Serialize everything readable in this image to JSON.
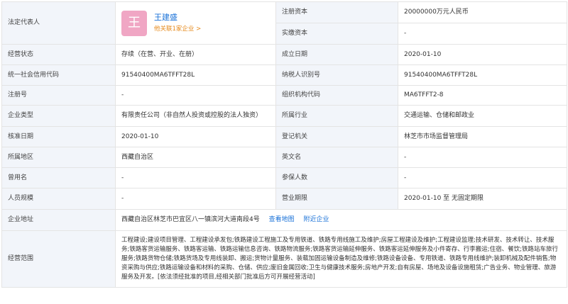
{
  "rows": {
    "legal_rep_label": "法定代表人",
    "rep_avatar_char": "王",
    "rep_name": "王建盛",
    "rep_link": "他关联1家企业 >",
    "reg_capital_label": "注册资本",
    "reg_capital_value": "20000000万元人民币",
    "paid_capital_label": "实缴资本",
    "paid_capital_value": "-",
    "status_label": "经营状态",
    "status_value": "存续（在营、开业、在册）",
    "established_label": "成立日期",
    "established_value": "2020-01-10",
    "credit_code_label": "统一社会信用代码",
    "credit_code_value": "91540400MA6TFFT28L",
    "taxpayer_label": "纳税人识别号",
    "taxpayer_value": "91540400MA6TFFT28L",
    "reg_no_label": "注册号",
    "reg_no_value": "-",
    "org_code_label": "组织机构代码",
    "org_code_value": "MA6TFFT2-8",
    "type_label": "企业类型",
    "type_value": "有限责任公司（非自然人投资或控股的法人独资）",
    "industry_label": "所属行业",
    "industry_value": "交通运输、仓储和邮政业",
    "approval_label": "核准日期",
    "approval_value": "2020-01-10",
    "authority_label": "登记机关",
    "authority_value": "林芝市市场监督管理局",
    "region_label": "所属地区",
    "region_value": "西藏自治区",
    "english_label": "英文名",
    "english_value": "-",
    "former_label": "曾用名",
    "former_value": "-",
    "insured_label": "参保人数",
    "insured_value": "-",
    "staff_label": "人员规模",
    "staff_value": "-",
    "term_label": "营业期限",
    "term_value": "2020-01-10 至 无固定期限",
    "address_label": "企业地址",
    "address_value": "西藏自治区林芝市巴宜区八一镇滨河大道南段4号",
    "map_link": "查看地图",
    "nearby_link": "附近企业",
    "scope_label": "经营范围",
    "scope_value": "工程建设;建设项目管理、工程建设承发包;铁路建设工程施工及专用铁道、铁路专用线施工及维护;房屋工程建设及维护;工程建设监理;技术研发、技术转让、技术服务;铁路客货运输服务、铁路客运输、铁路运输信息咨询、铁路物流服务;铁路客货运输延伸服务、铁路客运延伸服务及小件寄存、行李搬运;住宿、餐饮;铁路站车旅行服务;铁路货物仓储;铁路货场及专用线装卸、搬运;货物计量服务、装载加固运输设备制造及维修;铁路设备设备、专用铁道、铁路专用线维护;装卸机械及配件销售;物资采购与供应;铁路运输设备和材料的采购、仓储、供应;废旧金属回收;卫生与健康技术服务;房地产开发;自有房屋、场地及设备设施租赁;广告业务、物业管理、旅游服务及开发。[依法须经批准的项目,经相关部门批准后方可开展经营活动]"
  }
}
